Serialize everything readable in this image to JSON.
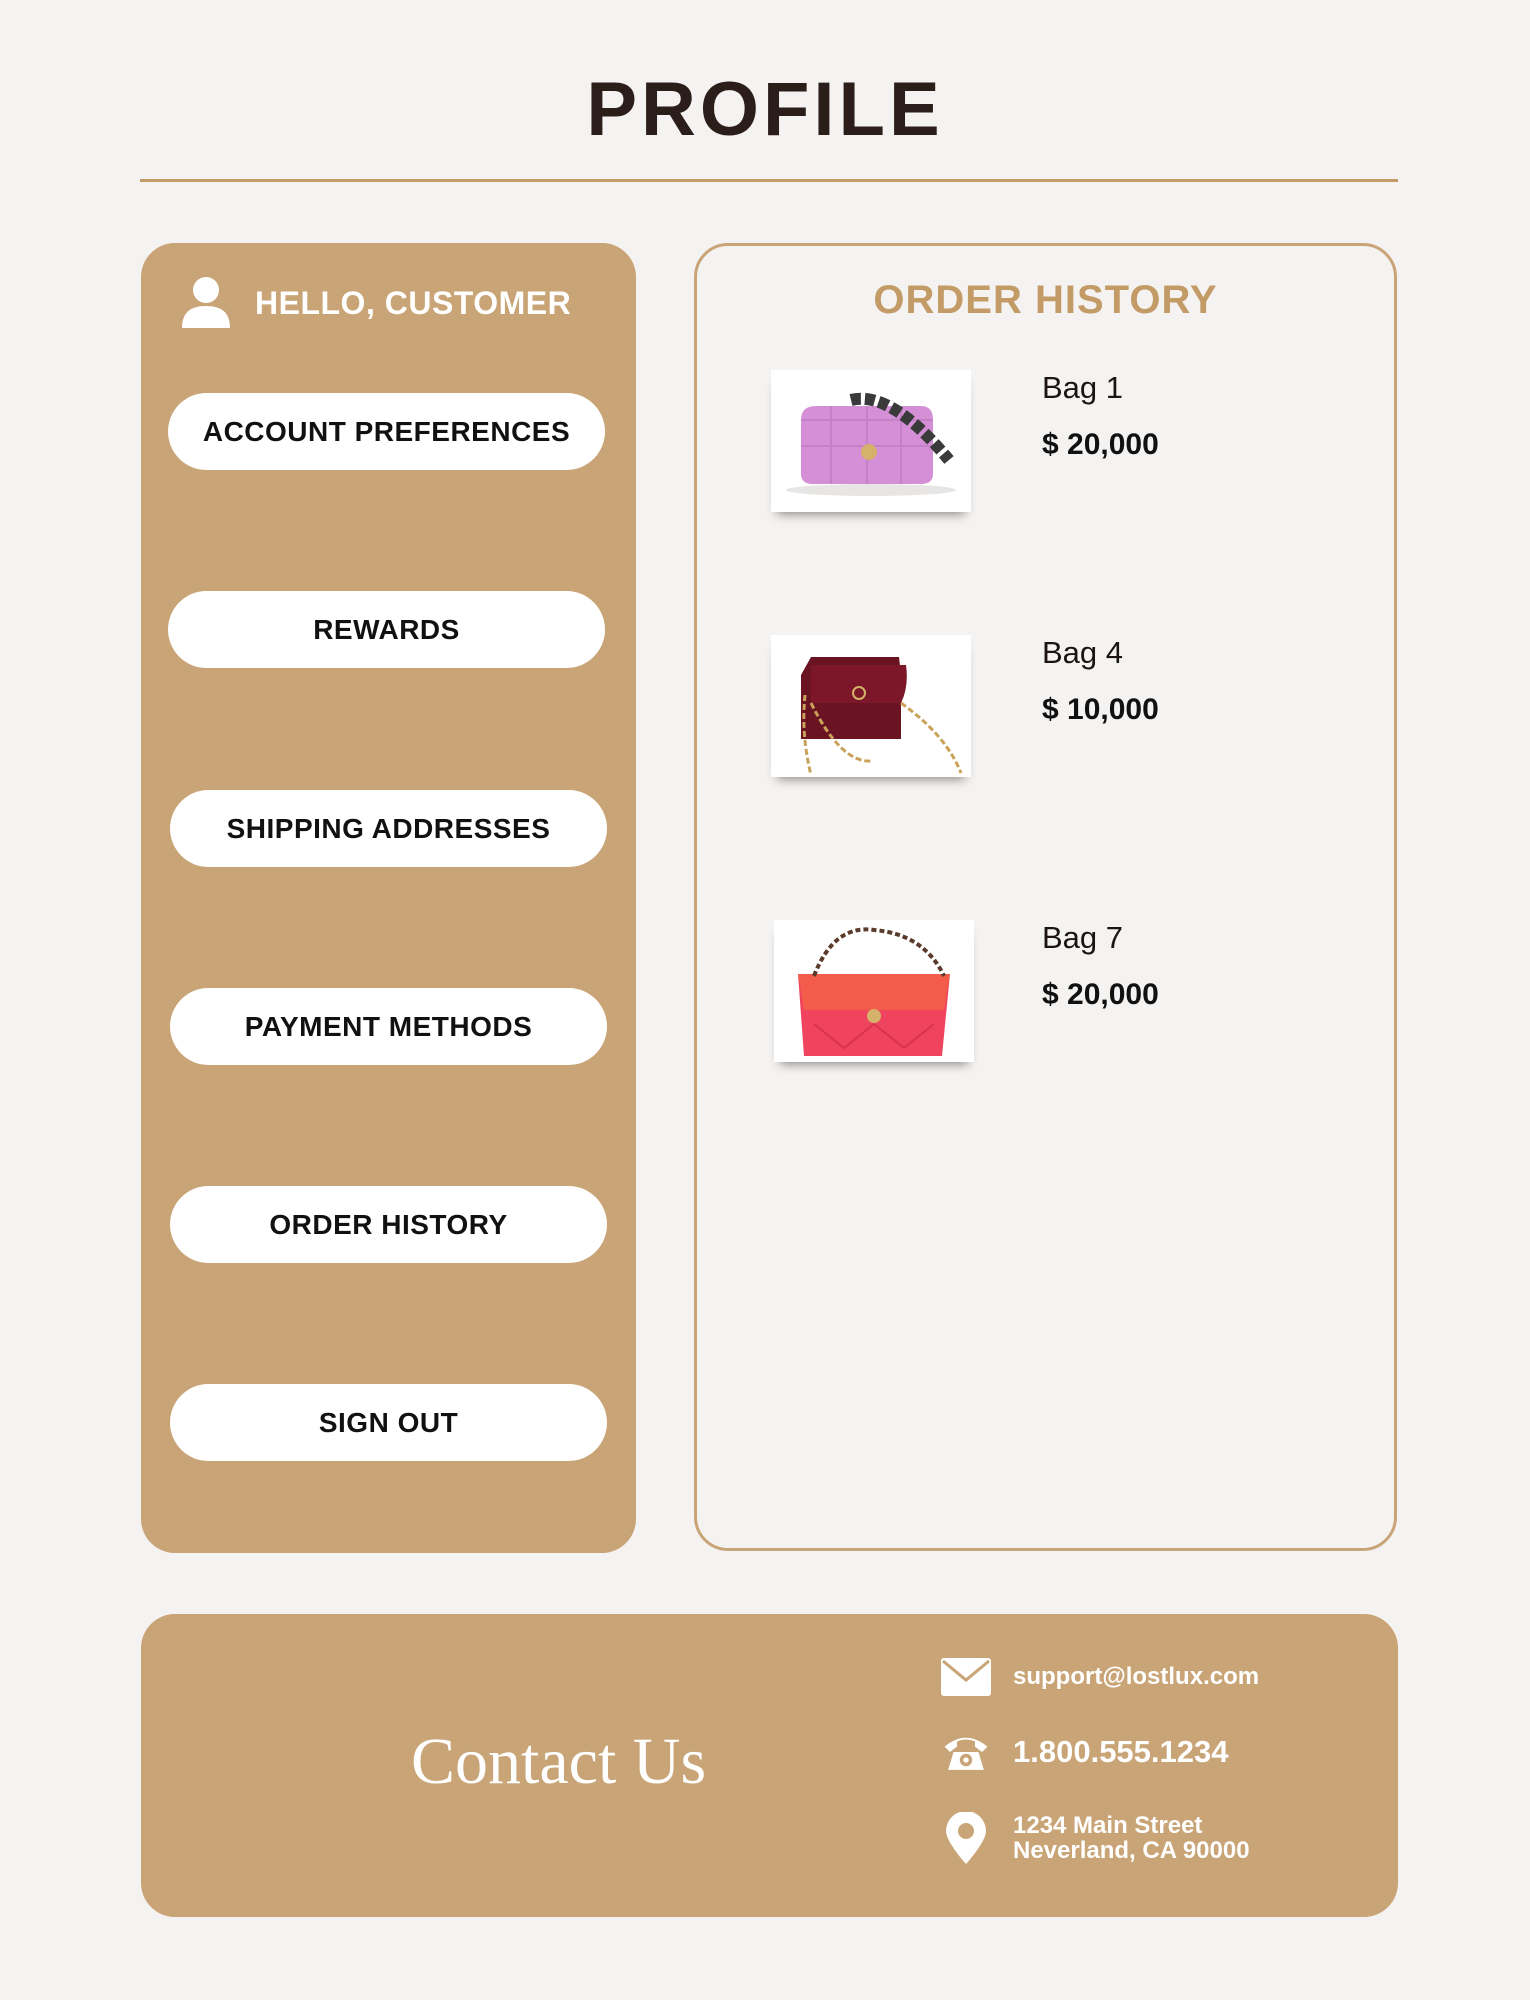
{
  "page": {
    "title": "PROFILE"
  },
  "sidebar": {
    "greeting": "HELLO, CUSTOMER",
    "items": [
      {
        "label": "ACCOUNT PREFERENCES"
      },
      {
        "label": "REWARDS"
      },
      {
        "label": "SHIPPING ADDRESSES"
      },
      {
        "label": "PAYMENT METHODS"
      },
      {
        "label": "ORDER HISTORY"
      },
      {
        "label": "SIGN OUT"
      }
    ]
  },
  "orders": {
    "title": "ORDER HISTORY",
    "items": [
      {
        "name": "Bag 1",
        "price": "$ 20,000",
        "color": "#d58fd6"
      },
      {
        "name": "Bag 4",
        "price": "$ 10,000",
        "color": "#7b1728"
      },
      {
        "name": "Bag 7",
        "price": "$ 20,000",
        "color": "#f0445e"
      }
    ]
  },
  "contact": {
    "title": "Contact Us",
    "email": "support@lostlux.com",
    "phone": "1.800.555.1234",
    "address_line1": "1234 Main Street",
    "address_line2": "Neverland, CA 90000"
  },
  "colors": {
    "accent": "#c9a476",
    "accent_text": "#c29b67",
    "background": "#f5f3f1"
  }
}
